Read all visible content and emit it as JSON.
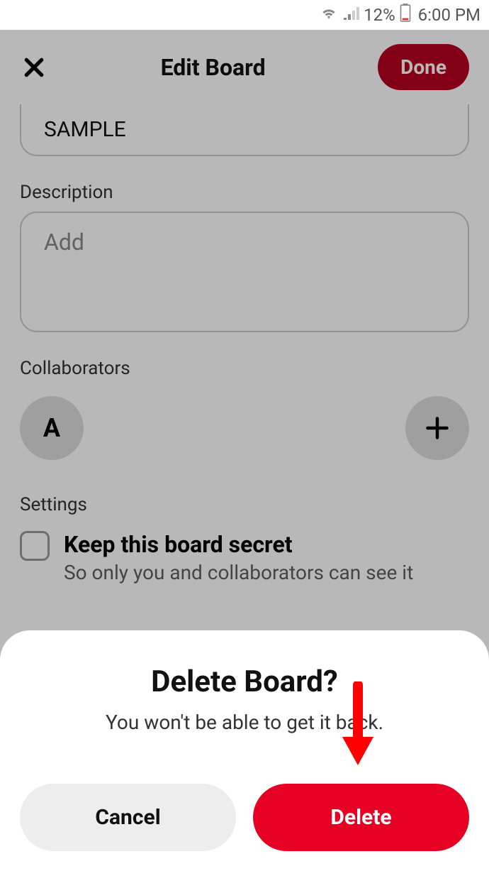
{
  "status_bar": {
    "battery_percent": "12%",
    "time": "6:00 PM"
  },
  "header": {
    "title": "Edit Board",
    "done_label": "Done"
  },
  "name_field": {
    "value": "SAMPLE"
  },
  "description": {
    "label": "Description",
    "placeholder": "Add"
  },
  "collaborators": {
    "label": "Collaborators",
    "avatar_initial": "A"
  },
  "settings": {
    "label": "Settings",
    "secret_title": "Keep this board secret",
    "secret_subtitle": "So only you and collaborators can see it"
  },
  "modal": {
    "title": "Delete Board?",
    "subtitle": "You won't be able to get it back.",
    "cancel_label": "Cancel",
    "delete_label": "Delete"
  }
}
